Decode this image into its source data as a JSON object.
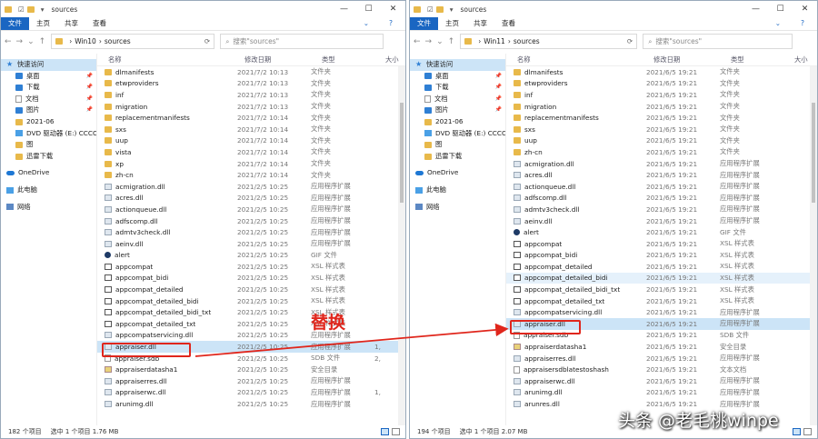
{
  "left": {
    "title": "sources",
    "menu": [
      "文件",
      "主页",
      "共享",
      "查看"
    ],
    "path": [
      "Win10",
      "sources"
    ],
    "search_placeholder": "搜索\"sources\"",
    "columns": [
      "名称",
      "修改日期",
      "类型",
      "大小"
    ],
    "sidebar": {
      "quick_access": "快速访问",
      "items": [
        "桌面",
        "下载",
        "文档",
        "图片",
        "2021-06",
        "DVD 驱动器 (E:) CCCO",
        "图",
        "迅雷下载"
      ],
      "onedrive": "OneDrive",
      "thispc": "此电脑",
      "network": "网络"
    },
    "files": [
      {
        "name": "dlmanifests",
        "date": "2021/7/2 10:13",
        "type": "文件夹",
        "size": "",
        "icon": "folder"
      },
      {
        "name": "etwproviders",
        "date": "2021/7/2 10:13",
        "type": "文件夹",
        "size": "",
        "icon": "folder"
      },
      {
        "name": "inf",
        "date": "2021/7/2 10:13",
        "type": "文件夹",
        "size": "",
        "icon": "folder"
      },
      {
        "name": "migration",
        "date": "2021/7/2 10:13",
        "type": "文件夹",
        "size": "",
        "icon": "folder"
      },
      {
        "name": "replacementmanifests",
        "date": "2021/7/2 10:14",
        "type": "文件夹",
        "size": "",
        "icon": "folder"
      },
      {
        "name": "sxs",
        "date": "2021/7/2 10:14",
        "type": "文件夹",
        "size": "",
        "icon": "folder"
      },
      {
        "name": "uup",
        "date": "2021/7/2 10:14",
        "type": "文件夹",
        "size": "",
        "icon": "folder"
      },
      {
        "name": "vista",
        "date": "2021/7/2 10:14",
        "type": "文件夹",
        "size": "",
        "icon": "folder"
      },
      {
        "name": "xp",
        "date": "2021/7/2 10:14",
        "type": "文件夹",
        "size": "",
        "icon": "folder"
      },
      {
        "name": "zh-cn",
        "date": "2021/7/2 10:14",
        "type": "文件夹",
        "size": "",
        "icon": "folder"
      },
      {
        "name": "acmigration.dll",
        "date": "2021/2/5 10:25",
        "type": "应用程序扩展",
        "size": "",
        "icon": "dll"
      },
      {
        "name": "acres.dll",
        "date": "2021/2/5 10:25",
        "type": "应用程序扩展",
        "size": "",
        "icon": "dll"
      },
      {
        "name": "actionqueue.dll",
        "date": "2021/2/5 10:25",
        "type": "应用程序扩展",
        "size": "",
        "icon": "dll"
      },
      {
        "name": "adfscomp.dll",
        "date": "2021/2/5 10:25",
        "type": "应用程序扩展",
        "size": "",
        "icon": "dll"
      },
      {
        "name": "admtv3check.dll",
        "date": "2021/2/5 10:25",
        "type": "应用程序扩展",
        "size": "",
        "icon": "dll"
      },
      {
        "name": "aeinv.dll",
        "date": "2021/2/5 10:25",
        "type": "应用程序扩展",
        "size": "",
        "icon": "dll"
      },
      {
        "name": "alert",
        "date": "2021/2/5 10:25",
        "type": "GIF 文件",
        "size": "",
        "icon": "gif"
      },
      {
        "name": "appcompat",
        "date": "2021/2/5 10:25",
        "type": "XSL 样式表",
        "size": "",
        "icon": "xsl"
      },
      {
        "name": "appcompat_bidi",
        "date": "2021/2/5 10:25",
        "type": "XSL 样式表",
        "size": "",
        "icon": "xsl"
      },
      {
        "name": "appcompat_detailed",
        "date": "2021/2/5 10:25",
        "type": "XSL 样式表",
        "size": "",
        "icon": "xsl"
      },
      {
        "name": "appcompat_detailed_bidi",
        "date": "2021/2/5 10:25",
        "type": "XSL 样式表",
        "size": "",
        "icon": "xsl"
      },
      {
        "name": "appcompat_detailed_bidi_txt",
        "date": "2021/2/5 10:25",
        "type": "XSL 样式表",
        "size": "",
        "icon": "xsl"
      },
      {
        "name": "appcompat_detailed_txt",
        "date": "2021/2/5 10:25",
        "type": "XSL 样式表",
        "size": "",
        "icon": "xsl"
      },
      {
        "name": "appcompatservicing.dll",
        "date": "2021/2/5 10:25",
        "type": "应用程序扩展",
        "size": "",
        "icon": "dll"
      },
      {
        "name": "appraiser.dll",
        "date": "2021/2/5 10:25",
        "type": "应用程序扩展",
        "size": "1,",
        "icon": "dll",
        "state": "sel"
      },
      {
        "name": "appraiser.sdb",
        "date": "2021/2/5 10:25",
        "type": "SDB 文件",
        "size": "2,",
        "icon": "doc"
      },
      {
        "name": "appraiserdatasha1",
        "date": "2021/2/5 10:25",
        "type": "安全目录",
        "size": "",
        "icon": "cat"
      },
      {
        "name": "appraiserres.dll",
        "date": "2021/2/5 10:25",
        "type": "应用程序扩展",
        "size": "",
        "icon": "dll"
      },
      {
        "name": "appraiserwc.dll",
        "date": "2021/2/5 10:25",
        "type": "应用程序扩展",
        "size": "1,",
        "icon": "dll"
      },
      {
        "name": "arunimg.dll",
        "date": "2021/2/5 10:25",
        "type": "应用程序扩展",
        "size": "",
        "icon": "dll"
      }
    ],
    "status_count": "182 个项目",
    "status_sel": "选中 1 个项目  1.76 MB"
  },
  "right": {
    "title": "sources",
    "menu": [
      "文件",
      "主页",
      "共享",
      "查看"
    ],
    "path": [
      "Win11",
      "sources"
    ],
    "search_placeholder": "搜索\"sources\"",
    "columns": [
      "名称",
      "修改日期",
      "类型",
      "大小"
    ],
    "sidebar": {
      "quick_access": "快速访问",
      "items": [
        "桌面",
        "下载",
        "文档",
        "图片",
        "2021-06",
        "DVD 驱动器 (E:) CCCO",
        "图",
        "迅雷下载"
      ],
      "onedrive": "OneDrive",
      "thispc": "此电脑",
      "network": "网络"
    },
    "files": [
      {
        "name": "dlmanifests",
        "date": "2021/6/5 19:21",
        "type": "文件夹",
        "size": "",
        "icon": "folder"
      },
      {
        "name": "etwproviders",
        "date": "2021/6/5 19:21",
        "type": "文件夹",
        "size": "",
        "icon": "folder"
      },
      {
        "name": "inf",
        "date": "2021/6/5 19:21",
        "type": "文件夹",
        "size": "",
        "icon": "folder"
      },
      {
        "name": "migration",
        "date": "2021/6/5 19:21",
        "type": "文件夹",
        "size": "",
        "icon": "folder"
      },
      {
        "name": "replacementmanifests",
        "date": "2021/6/5 19:21",
        "type": "文件夹",
        "size": "",
        "icon": "folder"
      },
      {
        "name": "sxs",
        "date": "2021/6/5 19:21",
        "type": "文件夹",
        "size": "",
        "icon": "folder"
      },
      {
        "name": "uup",
        "date": "2021/6/5 19:21",
        "type": "文件夹",
        "size": "",
        "icon": "folder"
      },
      {
        "name": "zh-cn",
        "date": "2021/6/5 19:21",
        "type": "文件夹",
        "size": "",
        "icon": "folder"
      },
      {
        "name": "acmigration.dll",
        "date": "2021/6/5 19:21",
        "type": "应用程序扩展",
        "size": "",
        "icon": "dll"
      },
      {
        "name": "acres.dll",
        "date": "2021/6/5 19:21",
        "type": "应用程序扩展",
        "size": "",
        "icon": "dll"
      },
      {
        "name": "actionqueue.dll",
        "date": "2021/6/5 19:21",
        "type": "应用程序扩展",
        "size": "",
        "icon": "dll"
      },
      {
        "name": "adfscomp.dll",
        "date": "2021/6/5 19:21",
        "type": "应用程序扩展",
        "size": "",
        "icon": "dll"
      },
      {
        "name": "admtv3check.dll",
        "date": "2021/6/5 19:21",
        "type": "应用程序扩展",
        "size": "",
        "icon": "dll"
      },
      {
        "name": "aeinv.dll",
        "date": "2021/6/5 19:21",
        "type": "应用程序扩展",
        "size": "",
        "icon": "dll"
      },
      {
        "name": "alert",
        "date": "2021/6/5 19:21",
        "type": "GIF 文件",
        "size": "",
        "icon": "gif"
      },
      {
        "name": "appcompat",
        "date": "2021/6/5 19:21",
        "type": "XSL 样式表",
        "size": "",
        "icon": "xsl"
      },
      {
        "name": "appcompat_bidi",
        "date": "2021/6/5 19:21",
        "type": "XSL 样式表",
        "size": "",
        "icon": "xsl"
      },
      {
        "name": "appcompat_detailed",
        "date": "2021/6/5 19:21",
        "type": "XSL 样式表",
        "size": "",
        "icon": "xsl"
      },
      {
        "name": "appcompat_detailed_bidi",
        "date": "2021/6/5 19:21",
        "type": "XSL 样式表",
        "size": "",
        "icon": "xsl",
        "state": "hl"
      },
      {
        "name": "appcompat_detailed_bidi_txt",
        "date": "2021/6/5 19:21",
        "type": "XSL 样式表",
        "size": "",
        "icon": "xsl"
      },
      {
        "name": "appcompat_detailed_txt",
        "date": "2021/6/5 19:21",
        "type": "XSL 样式表",
        "size": "",
        "icon": "xsl"
      },
      {
        "name": "appcompatservicing.dll",
        "date": "2021/6/5 19:21",
        "type": "应用程序扩展",
        "size": "",
        "icon": "dll"
      },
      {
        "name": "appraiser.dll",
        "date": "2021/6/5 19:21",
        "type": "应用程序扩展",
        "size": "",
        "icon": "dll",
        "state": "sel"
      },
      {
        "name": "appraiser.sdb",
        "date": "2021/6/5 19:21",
        "type": "SDB 文件",
        "size": "",
        "icon": "doc"
      },
      {
        "name": "appraiserdatasha1",
        "date": "2021/6/5 19:21",
        "type": "安全目录",
        "size": "",
        "icon": "cat"
      },
      {
        "name": "appraiserres.dll",
        "date": "2021/6/5 19:21",
        "type": "应用程序扩展",
        "size": "",
        "icon": "dll"
      },
      {
        "name": "appraisersdblatestoshash",
        "date": "2021/6/5 19:21",
        "type": "文本文档",
        "size": "",
        "icon": "doc"
      },
      {
        "name": "appraiserwc.dll",
        "date": "2021/6/5 19:21",
        "type": "应用程序扩展",
        "size": "",
        "icon": "dll"
      },
      {
        "name": "arunimg.dll",
        "date": "2021/6/5 19:21",
        "type": "应用程序扩展",
        "size": "",
        "icon": "dll"
      },
      {
        "name": "arunres.dll",
        "date": "2021/6/5 19:21",
        "type": "应用程序扩展",
        "size": "",
        "icon": "dll"
      }
    ],
    "status_count": "194 个项目",
    "status_sel": "选中 1 个项目  2.07 MB"
  },
  "annotation": {
    "replace_label": "替换",
    "color": "#e0261c"
  },
  "watermark": "头条 @老毛桃winpe"
}
